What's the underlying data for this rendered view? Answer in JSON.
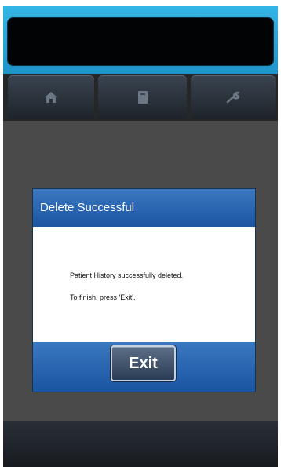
{
  "tabs": [
    {
      "icon": "home-icon"
    },
    {
      "icon": "book-icon"
    },
    {
      "icon": "wrench-icon"
    }
  ],
  "dialog": {
    "title": "Delete Successful",
    "message_line1": "Patient History successfully deleted.",
    "message_line2": "To finish, press 'Exit'.",
    "exit_label": "Exit"
  },
  "colors": {
    "top_bar": "#1e94cb",
    "dialog_header": "#1a54a2",
    "screen_background": "#4a4a4b"
  }
}
